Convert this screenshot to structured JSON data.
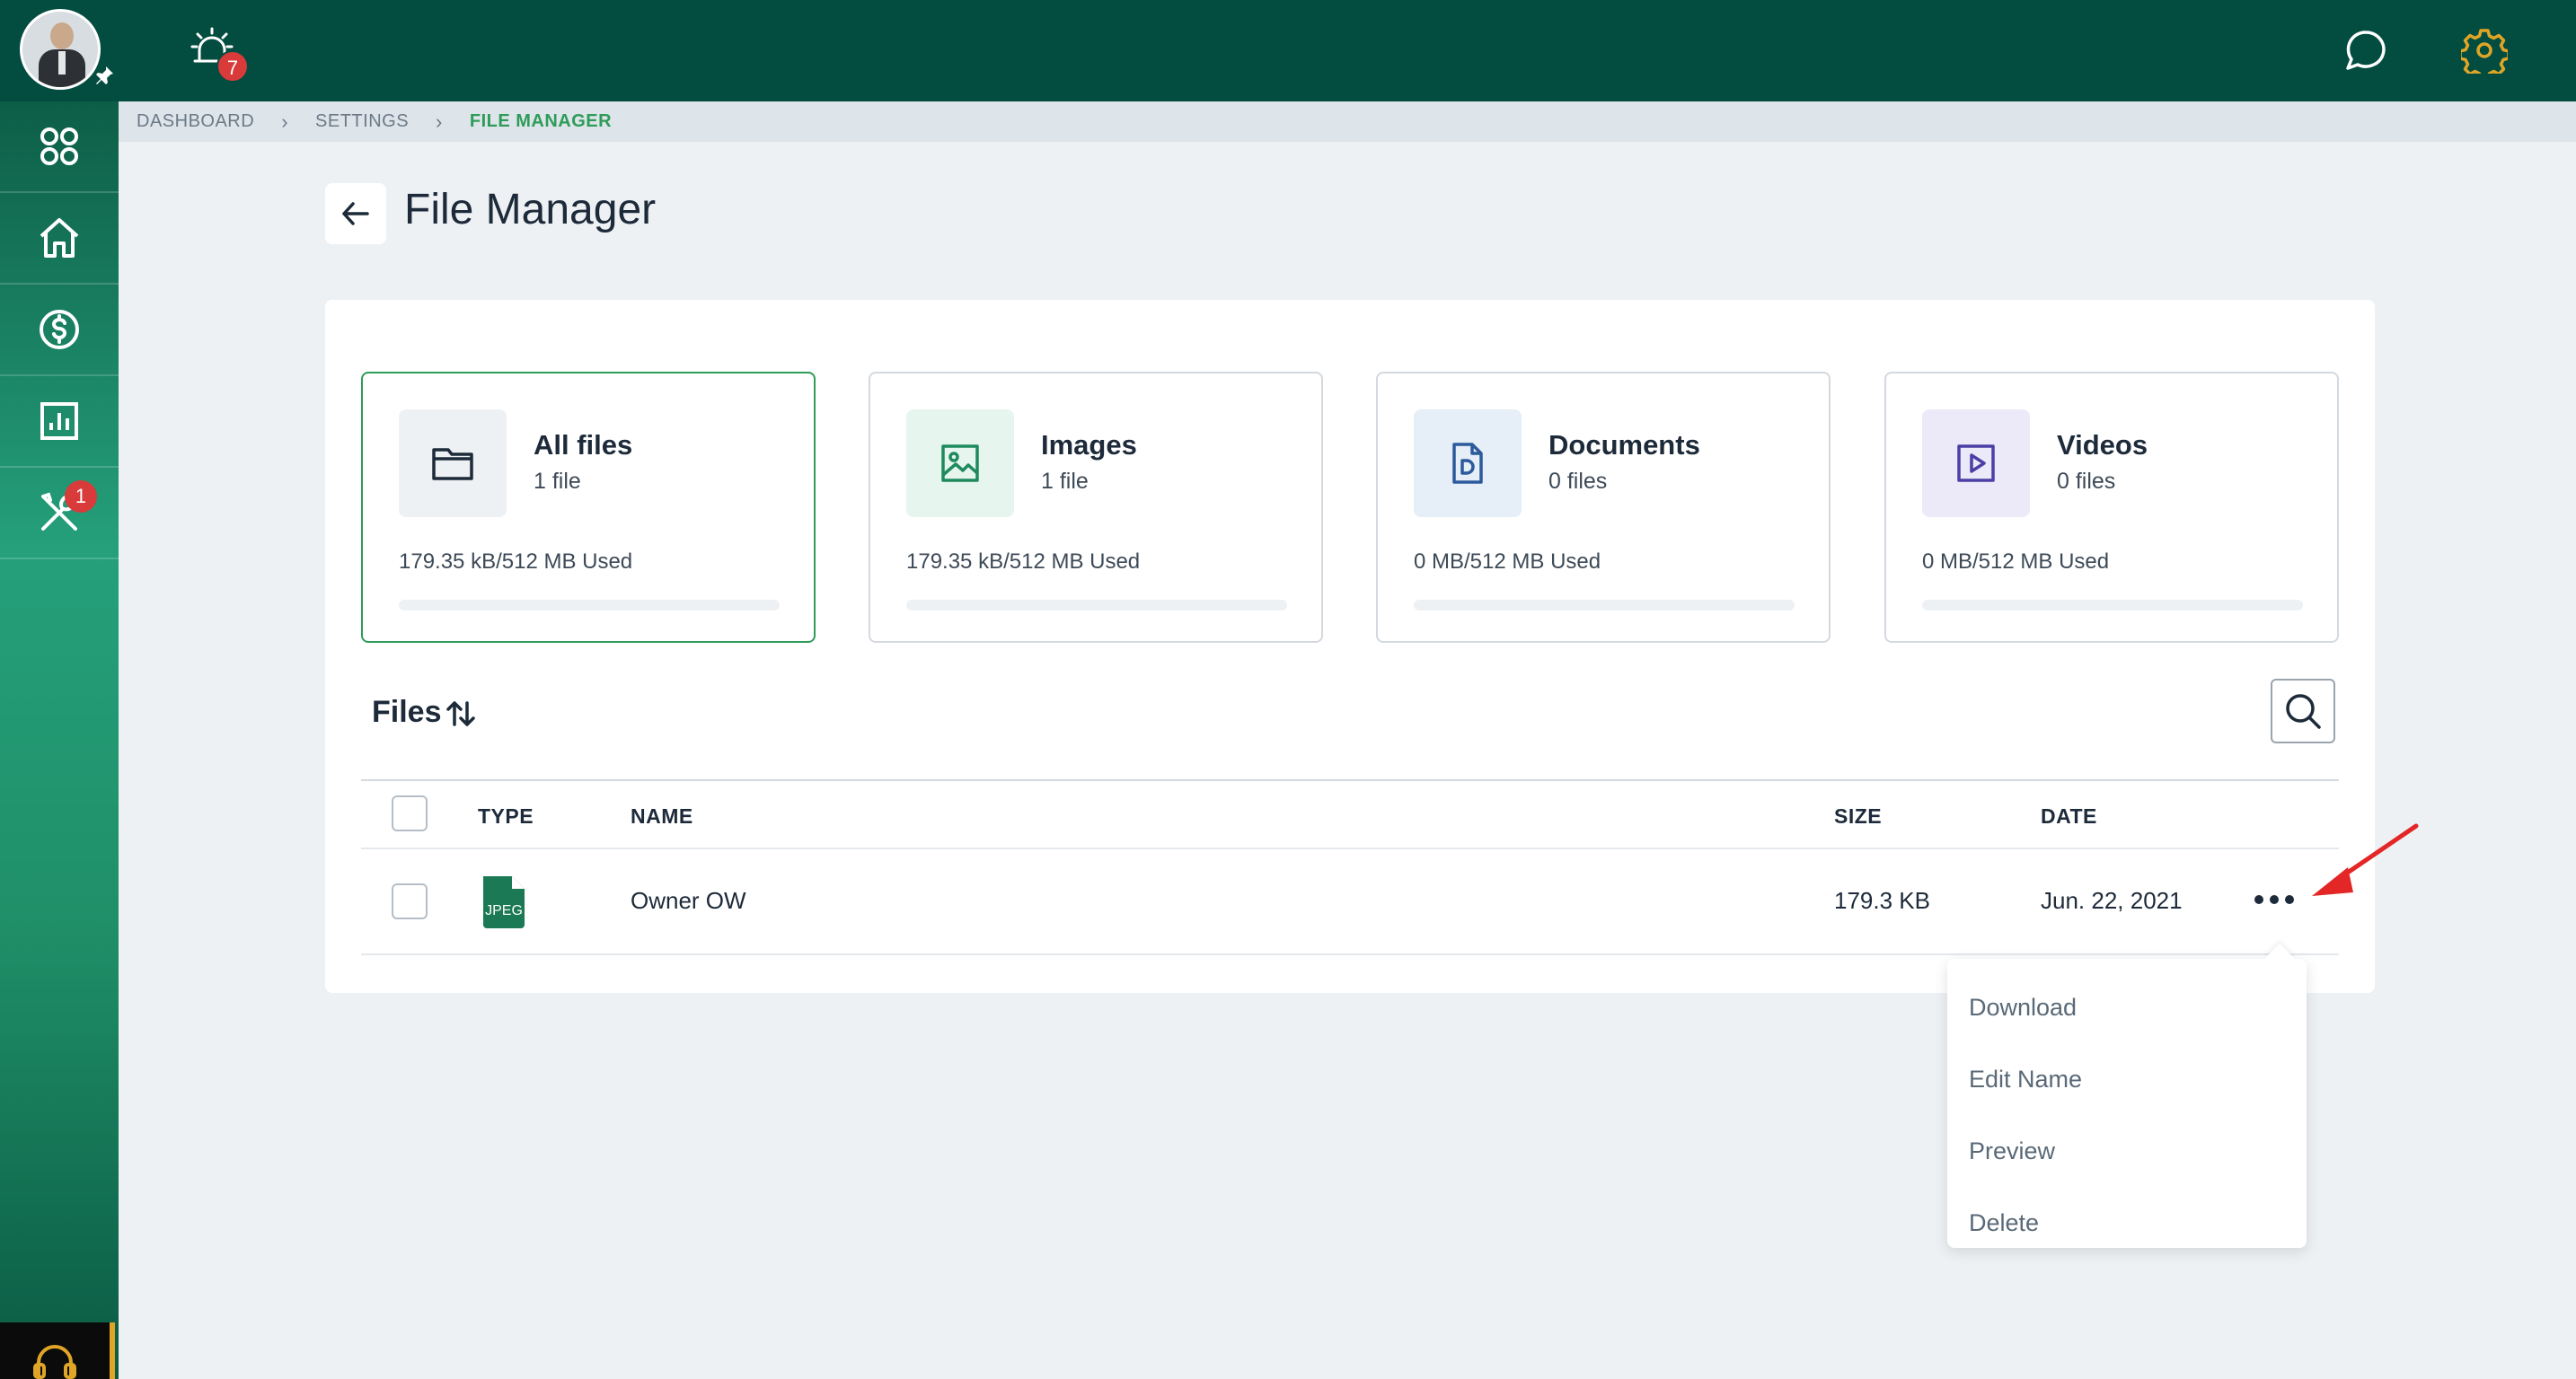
{
  "topbar": {
    "notification_count": "7",
    "icons": [
      "avatar",
      "pin-icon",
      "alarm-icon",
      "chat-icon",
      "gear-icon"
    ]
  },
  "sidebar": {
    "items": [
      {
        "name": "apps",
        "icon": "apps-grid-icon"
      },
      {
        "name": "home",
        "icon": "home-icon"
      },
      {
        "name": "billing",
        "icon": "dollar-icon"
      },
      {
        "name": "reports",
        "icon": "chart-icon"
      },
      {
        "name": "tools",
        "icon": "tools-icon",
        "badge": "1"
      }
    ],
    "support_icon": "headset-icon"
  },
  "breadcrumb": {
    "items": [
      "DASHBOARD",
      "SETTINGS"
    ],
    "current": "FILE MANAGER"
  },
  "page": {
    "title": "File Manager"
  },
  "categories": [
    {
      "title": "All files",
      "count": "1 file",
      "used": "179.35 kB/512 MB Used",
      "active": true,
      "icon": "folder-icon",
      "color": "#1d2a3a",
      "bg": "#eef1f4"
    },
    {
      "title": "Images",
      "count": "1 file",
      "used": "179.35 kB/512 MB Used",
      "active": false,
      "icon": "image-icon",
      "color": "#1f8a5e",
      "bg": "#e6f6ee"
    },
    {
      "title": "Documents",
      "count": "0 files",
      "used": "0 MB/512 MB Used",
      "active": false,
      "icon": "document-icon",
      "color": "#2d5a9c",
      "bg": "#e6eef8"
    },
    {
      "title": "Videos",
      "count": "0 files",
      "used": "0 MB/512 MB Used",
      "active": false,
      "icon": "video-icon",
      "color": "#4b3fa6",
      "bg": "#eceaf8"
    }
  ],
  "files": {
    "title": "Files",
    "columns": {
      "type": "TYPE",
      "name": "NAME",
      "size": "SIZE",
      "date": "DATE"
    },
    "rows": [
      {
        "type": "JPEG",
        "name": "Owner OW",
        "size": "179.3 KB",
        "date": "Jun. 22, 2021"
      }
    ]
  },
  "menu": {
    "items": [
      "Download",
      "Edit Name",
      "Preview",
      "Delete"
    ]
  },
  "colors": {
    "topbar": "#034d40",
    "accent_green": "#2e9c58",
    "badge_red": "#d93a3a",
    "gear_orange": "#e0a526",
    "annotation_arrow": "#e32626"
  }
}
